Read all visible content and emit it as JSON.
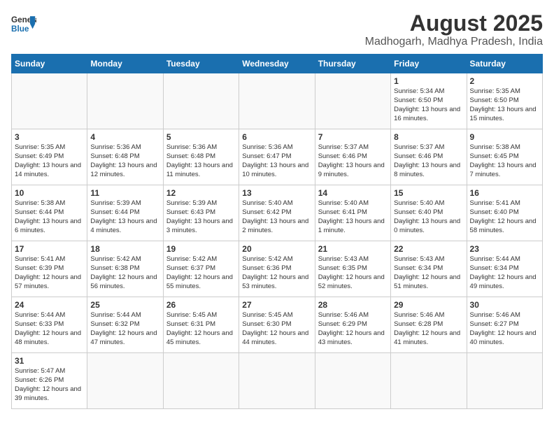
{
  "header": {
    "logo_general": "General",
    "logo_blue": "Blue",
    "title": "August 2025",
    "subtitle": "Madhogarh, Madhya Pradesh, India"
  },
  "calendar": {
    "days_of_week": [
      "Sunday",
      "Monday",
      "Tuesday",
      "Wednesday",
      "Thursday",
      "Friday",
      "Saturday"
    ],
    "weeks": [
      [
        {
          "day": "",
          "info": ""
        },
        {
          "day": "",
          "info": ""
        },
        {
          "day": "",
          "info": ""
        },
        {
          "day": "",
          "info": ""
        },
        {
          "day": "",
          "info": ""
        },
        {
          "day": "1",
          "info": "Sunrise: 5:34 AM\nSunset: 6:50 PM\nDaylight: 13 hours and 16 minutes."
        },
        {
          "day": "2",
          "info": "Sunrise: 5:35 AM\nSunset: 6:50 PM\nDaylight: 13 hours and 15 minutes."
        }
      ],
      [
        {
          "day": "3",
          "info": "Sunrise: 5:35 AM\nSunset: 6:49 PM\nDaylight: 13 hours and 14 minutes."
        },
        {
          "day": "4",
          "info": "Sunrise: 5:36 AM\nSunset: 6:48 PM\nDaylight: 13 hours and 12 minutes."
        },
        {
          "day": "5",
          "info": "Sunrise: 5:36 AM\nSunset: 6:48 PM\nDaylight: 13 hours and 11 minutes."
        },
        {
          "day": "6",
          "info": "Sunrise: 5:36 AM\nSunset: 6:47 PM\nDaylight: 13 hours and 10 minutes."
        },
        {
          "day": "7",
          "info": "Sunrise: 5:37 AM\nSunset: 6:46 PM\nDaylight: 13 hours and 9 minutes."
        },
        {
          "day": "8",
          "info": "Sunrise: 5:37 AM\nSunset: 6:46 PM\nDaylight: 13 hours and 8 minutes."
        },
        {
          "day": "9",
          "info": "Sunrise: 5:38 AM\nSunset: 6:45 PM\nDaylight: 13 hours and 7 minutes."
        }
      ],
      [
        {
          "day": "10",
          "info": "Sunrise: 5:38 AM\nSunset: 6:44 PM\nDaylight: 13 hours and 6 minutes."
        },
        {
          "day": "11",
          "info": "Sunrise: 5:39 AM\nSunset: 6:44 PM\nDaylight: 13 hours and 4 minutes."
        },
        {
          "day": "12",
          "info": "Sunrise: 5:39 AM\nSunset: 6:43 PM\nDaylight: 13 hours and 3 minutes."
        },
        {
          "day": "13",
          "info": "Sunrise: 5:40 AM\nSunset: 6:42 PM\nDaylight: 13 hours and 2 minutes."
        },
        {
          "day": "14",
          "info": "Sunrise: 5:40 AM\nSunset: 6:41 PM\nDaylight: 13 hours and 1 minute."
        },
        {
          "day": "15",
          "info": "Sunrise: 5:40 AM\nSunset: 6:40 PM\nDaylight: 13 hours and 0 minutes."
        },
        {
          "day": "16",
          "info": "Sunrise: 5:41 AM\nSunset: 6:40 PM\nDaylight: 12 hours and 58 minutes."
        }
      ],
      [
        {
          "day": "17",
          "info": "Sunrise: 5:41 AM\nSunset: 6:39 PM\nDaylight: 12 hours and 57 minutes."
        },
        {
          "day": "18",
          "info": "Sunrise: 5:42 AM\nSunset: 6:38 PM\nDaylight: 12 hours and 56 minutes."
        },
        {
          "day": "19",
          "info": "Sunrise: 5:42 AM\nSunset: 6:37 PM\nDaylight: 12 hours and 55 minutes."
        },
        {
          "day": "20",
          "info": "Sunrise: 5:42 AM\nSunset: 6:36 PM\nDaylight: 12 hours and 53 minutes."
        },
        {
          "day": "21",
          "info": "Sunrise: 5:43 AM\nSunset: 6:35 PM\nDaylight: 12 hours and 52 minutes."
        },
        {
          "day": "22",
          "info": "Sunrise: 5:43 AM\nSunset: 6:34 PM\nDaylight: 12 hours and 51 minutes."
        },
        {
          "day": "23",
          "info": "Sunrise: 5:44 AM\nSunset: 6:34 PM\nDaylight: 12 hours and 49 minutes."
        }
      ],
      [
        {
          "day": "24",
          "info": "Sunrise: 5:44 AM\nSunset: 6:33 PM\nDaylight: 12 hours and 48 minutes."
        },
        {
          "day": "25",
          "info": "Sunrise: 5:44 AM\nSunset: 6:32 PM\nDaylight: 12 hours and 47 minutes."
        },
        {
          "day": "26",
          "info": "Sunrise: 5:45 AM\nSunset: 6:31 PM\nDaylight: 12 hours and 45 minutes."
        },
        {
          "day": "27",
          "info": "Sunrise: 5:45 AM\nSunset: 6:30 PM\nDaylight: 12 hours and 44 minutes."
        },
        {
          "day": "28",
          "info": "Sunrise: 5:46 AM\nSunset: 6:29 PM\nDaylight: 12 hours and 43 minutes."
        },
        {
          "day": "29",
          "info": "Sunrise: 5:46 AM\nSunset: 6:28 PM\nDaylight: 12 hours and 41 minutes."
        },
        {
          "day": "30",
          "info": "Sunrise: 5:46 AM\nSunset: 6:27 PM\nDaylight: 12 hours and 40 minutes."
        }
      ],
      [
        {
          "day": "31",
          "info": "Sunrise: 5:47 AM\nSunset: 6:26 PM\nDaylight: 12 hours and 39 minutes."
        },
        {
          "day": "",
          "info": ""
        },
        {
          "day": "",
          "info": ""
        },
        {
          "day": "",
          "info": ""
        },
        {
          "day": "",
          "info": ""
        },
        {
          "day": "",
          "info": ""
        },
        {
          "day": "",
          "info": ""
        }
      ]
    ]
  }
}
